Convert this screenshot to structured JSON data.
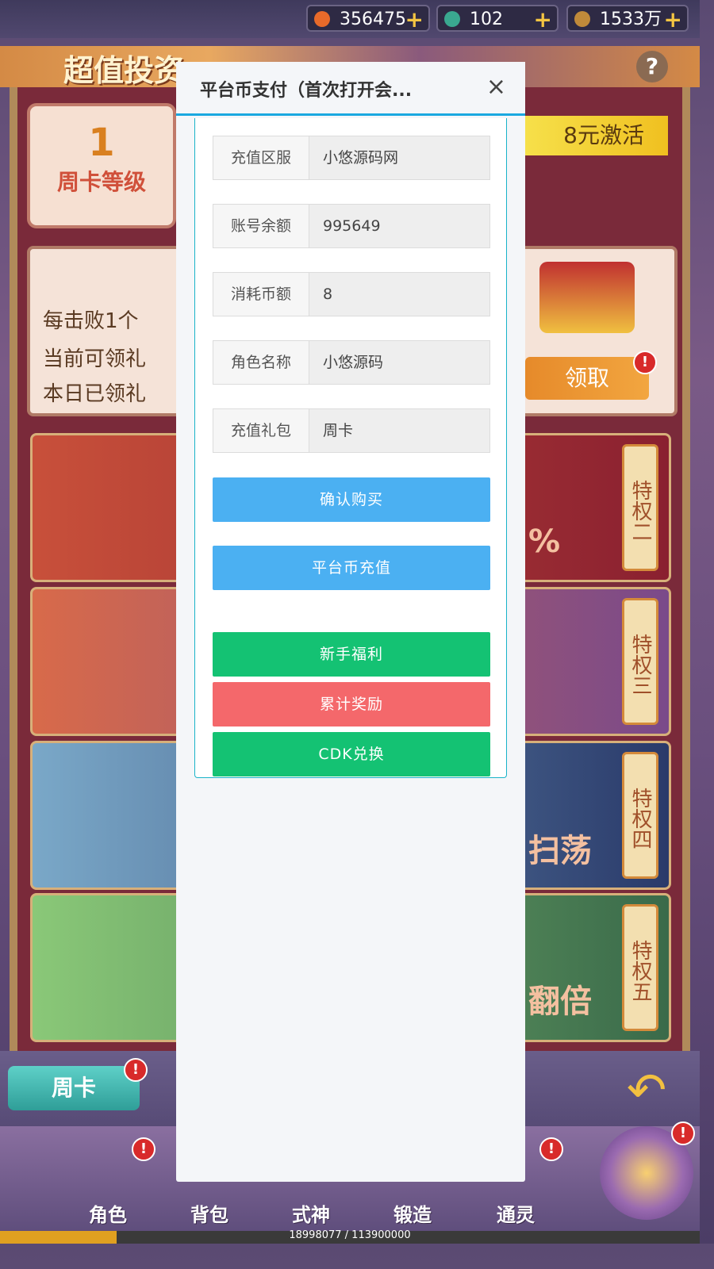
{
  "currencies": [
    {
      "value": "356475",
      "icon": "gem-icon",
      "plus": "+"
    },
    {
      "value": "102",
      "icon": "jade-icon",
      "plus": "+"
    },
    {
      "value": "1533万",
      "icon": "coin-icon",
      "plus": "+"
    }
  ],
  "header": {
    "title": "超值投资",
    "help": "?"
  },
  "level_card": {
    "level": "1",
    "label": "周卡等级"
  },
  "activate_label": "8元激活",
  "info_lines": [
    "每击败1个",
    "当前可领礼",
    "本日已领礼"
  ],
  "claim_button": "领取",
  "privileges": [
    "特权二",
    "特权三",
    "特权四",
    "特权五"
  ],
  "priv_row_texts": [
    "%",
    "",
    "扫荡",
    "翻倍"
  ],
  "week_card_tab": "周卡",
  "nav": [
    "角色",
    "背包",
    "式神",
    "锻造",
    "通灵"
  ],
  "xp": {
    "text": "18998077 / 113900000",
    "fraction": 0.1668
  },
  "badge": "!",
  "modal": {
    "title": "平台币支付（首次打开会...",
    "close": "×",
    "fields": [
      {
        "label": "充值区服",
        "value": "小悠源码网"
      },
      {
        "label": "账号余额",
        "value": "995649"
      },
      {
        "label": "消耗币额",
        "value": "8"
      },
      {
        "label": "角色名称",
        "value": "小悠源码"
      },
      {
        "label": "充值礼包",
        "value": "周卡"
      }
    ],
    "buttons": {
      "confirm": "确认购买",
      "recharge": "平台币充值",
      "newbie": "新手福利",
      "cumulative": "累计奖励",
      "cdk": "CDK兑换"
    }
  }
}
